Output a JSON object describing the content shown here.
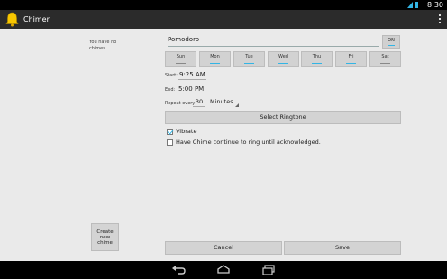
{
  "status": {
    "time": "8:30"
  },
  "app": {
    "title": "Chimer"
  },
  "sidebar": {
    "empty_text": "You have no chimes.",
    "create_button": "Create new chime"
  },
  "chime": {
    "name": "Pomodoro",
    "toggle": "ON",
    "days": [
      {
        "label": "Sun",
        "active": false
      },
      {
        "label": "Mon",
        "active": true
      },
      {
        "label": "Tue",
        "active": true
      },
      {
        "label": "Wed",
        "active": true
      },
      {
        "label": "Thu",
        "active": true
      },
      {
        "label": "Fri",
        "active": true
      },
      {
        "label": "Sat",
        "active": false
      }
    ],
    "start_label": "Start:",
    "start_time": "9:25 AM",
    "end_label": "End:",
    "end_time": "5:00 PM",
    "repeat_label": "Repeat every",
    "repeat_value": "30",
    "repeat_unit": "Minutes",
    "ringtone_button": "Select Ringtone",
    "vibrate_label": "Vibrate",
    "vibrate_checked": true,
    "continue_label": "Have Chime continue to ring until acknowledged.",
    "continue_checked": false
  },
  "footer": {
    "cancel": "Cancel",
    "save": "Save"
  },
  "colors": {
    "accent": "#33b5e5",
    "action_bar": "#2b2b2b"
  }
}
